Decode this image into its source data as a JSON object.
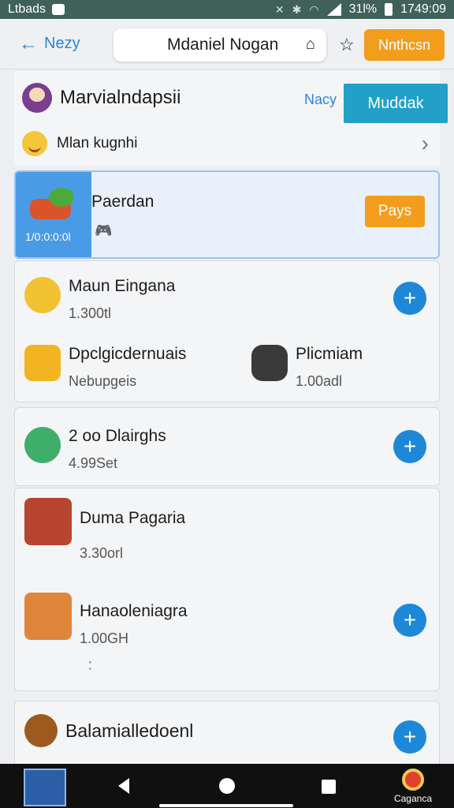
{
  "status_bar": {
    "left_text": "Ltbads",
    "right_percent": "31l%",
    "time": "1749:09"
  },
  "top_bar": {
    "back_label": "Nezy",
    "title": "Mdaniel Nogan",
    "action_button": "Nnthcsn"
  },
  "profile": {
    "name": "Marvialndapsii",
    "link": "Nacy",
    "button": "Muddak"
  },
  "subheader": {
    "label": "Mlan kugnhi"
  },
  "featured": {
    "left_caption": "1/0:0:0:0l",
    "title": "Paerdan",
    "play_button": "Pays"
  },
  "items": [
    {
      "name": "Maun Eingana",
      "meta": "1.300tl"
    },
    {
      "name": "Dpclgicdernuais",
      "meta": "Nebupgeis"
    },
    {
      "name": "Plicmiam",
      "meta": "1.00adl"
    },
    {
      "name": "2 oo Dlairghs",
      "meta": "4.99Set"
    },
    {
      "name": "Duma Pagaria",
      "meta": "3.30orl"
    },
    {
      "name": "Hanaoleniagra",
      "meta": "1.00GH"
    },
    {
      "name": "Balamialledoenl",
      "meta": ""
    }
  ],
  "nav": {
    "app_label": "Caganca"
  },
  "colors": {
    "accent_blue": "#1e88d8",
    "accent_orange": "#f39d1c",
    "teal": "#22a0c8",
    "status_bar": "#3f6159"
  }
}
